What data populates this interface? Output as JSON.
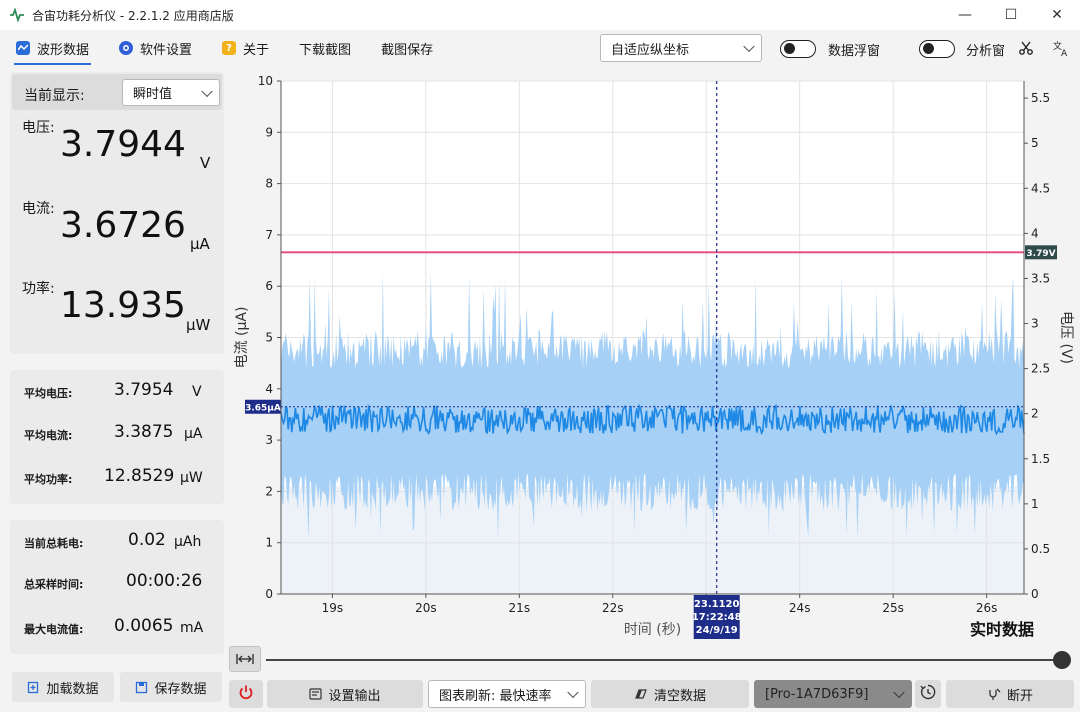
{
  "window": {
    "title": "合宙功耗分析仪 - 2.2.1.2 应用商店版",
    "minimize_glyph": "—",
    "maximize_glyph": "☐",
    "close_glyph": "✕"
  },
  "menu": {
    "waveform": "波形数据",
    "settings": "软件设置",
    "about": "关于",
    "about_icon_glyph": "?",
    "download_screenshot": "下载截图",
    "save_screenshot": "截图保存"
  },
  "toolbar": {
    "axis_mode": "自适应纵坐标",
    "float_window_label": "数据浮窗",
    "analysis_window_label": "分析窗"
  },
  "readout": {
    "display_label": "当前显示:",
    "display_mode": "瞬时值",
    "voltage_label": "电压:",
    "voltage_value": "3.7944",
    "voltage_unit": "V",
    "current_label": "电流:",
    "current_value": "3.6726",
    "current_unit": "μA",
    "power_label": "功率:",
    "power_value": "13.935",
    "power_unit": "μW"
  },
  "averages": {
    "avg_voltage_label": "平均电压:",
    "avg_voltage_value": "3.7954",
    "avg_voltage_unit": "V",
    "avg_current_label": "平均电流:",
    "avg_current_value": "3.3875",
    "avg_current_unit": "μA",
    "avg_power_label": "平均功率:",
    "avg_power_value": "12.8529",
    "avg_power_unit": "μW"
  },
  "totals": {
    "consumption_label": "当前总耗电:",
    "consumption_value": "0.02",
    "consumption_unit": "μAh",
    "sample_time_label": "总采样时间:",
    "sample_time_value": "00:00:26",
    "max_current_label": "最大电流值:",
    "max_current_value": "0.0065",
    "max_current_unit": "mA"
  },
  "actions": {
    "load_data": "加载数据",
    "save_data": "保存数据",
    "set_output": "设置输出",
    "refresh_mode": "图表刷新: 最快速率",
    "clear_data": "清空数据",
    "device": "[Pro-1A7D63F9]",
    "disconnect": "断开"
  },
  "colors": {
    "current_fill": "#a6d0f5",
    "current_line": "#1e88e5",
    "voltage_line": "#e8457a",
    "cursor_line": "#1f2d8a",
    "current_tag": "#1f2d8a",
    "voltage_tag": "#2f4a4a"
  },
  "chart_data": {
    "type": "area",
    "xlabel": "时间 (秒)",
    "ylabel": "电流 (μA)",
    "y2label": "电压 (V)",
    "corner_label": "实时数据",
    "xlim": [
      18.45,
      26.4
    ],
    "x_ticks": [
      19,
      20,
      21,
      22,
      23,
      24,
      25,
      26
    ],
    "x_tick_labels": [
      "19s",
      "20s",
      "21s",
      "22s",
      "23s",
      "24s",
      "25s",
      "26s"
    ],
    "ylim": [
      0,
      10
    ],
    "y_ticks": [
      0,
      1,
      2,
      3,
      4,
      5,
      6,
      7,
      8,
      9,
      10
    ],
    "y_tick_labels": [
      "0",
      "1",
      "2",
      "3",
      "4",
      "5",
      "6",
      "7",
      "8",
      "9",
      "10"
    ],
    "y2lim": [
      0,
      5.69
    ],
    "y2_ticks": [
      0,
      0.5,
      1,
      1.5,
      2,
      2.5,
      3,
      3.5,
      4,
      4.5,
      5,
      5.5
    ],
    "y2_tick_labels": [
      "0",
      "0.5",
      "1",
      "1.5",
      "2",
      "2.5",
      "3",
      "3.5",
      "4",
      "4.5",
      "5",
      "5.5"
    ],
    "grid": true,
    "series": [
      {
        "name": "电流",
        "axis": "left",
        "mean": 3.4,
        "band_low": 1.9,
        "band_high": 4.85,
        "peak_max": 6.3,
        "dip_min": 1.0
      },
      {
        "name": "电压",
        "axis": "right",
        "value": 3.79
      }
    ],
    "current_marker_value": 3.65,
    "current_marker_label": "3.65μA",
    "voltage_marker_label": "3.79V",
    "cursor": {
      "x": 23.112,
      "label_lines": [
        "23.1120",
        "17:22:48",
        "24/9/19"
      ]
    }
  }
}
